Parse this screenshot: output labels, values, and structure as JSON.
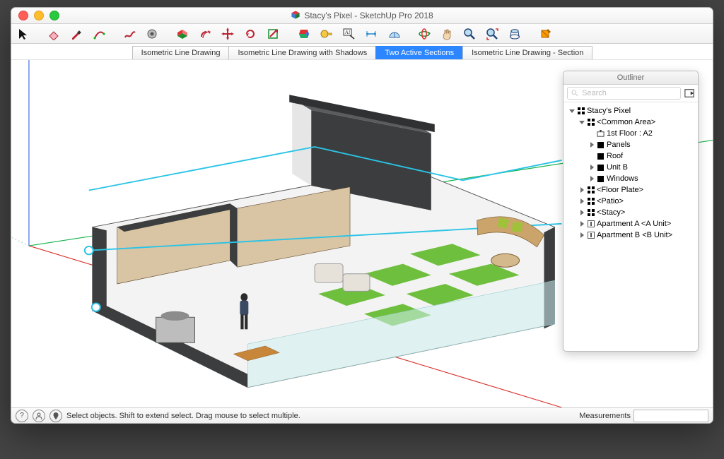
{
  "window": {
    "title": "Stacy's Pixel - SketchUp Pro 2018"
  },
  "scene_tabs": [
    {
      "label": "Isometric Line Drawing",
      "active": false
    },
    {
      "label": "Isometric Line Drawing with Shadows",
      "active": false
    },
    {
      "label": "Two Active Sections",
      "active": true
    },
    {
      "label": "Isometric Line Drawing - Section",
      "active": false
    }
  ],
  "outliner": {
    "title": "Outliner",
    "search_placeholder": "Search",
    "tree": [
      {
        "depth": 0,
        "arrow": "down",
        "icon": "open4",
        "label": "Stacy's Pixel"
      },
      {
        "depth": 1,
        "arrow": "down",
        "icon": "open4",
        "label": "<Common Area>"
      },
      {
        "depth": 2,
        "arrow": "none",
        "icon": "section",
        "label": "1st Floor : A2"
      },
      {
        "depth": 2,
        "arrow": "right",
        "icon": "solid",
        "label": "Panels"
      },
      {
        "depth": 2,
        "arrow": "none",
        "icon": "solid",
        "label": "Roof"
      },
      {
        "depth": 2,
        "arrow": "right",
        "icon": "solid",
        "label": "Unit B"
      },
      {
        "depth": 2,
        "arrow": "right",
        "icon": "solid",
        "label": "Windows"
      },
      {
        "depth": 1,
        "arrow": "right",
        "icon": "open4",
        "label": "<Floor Plate>"
      },
      {
        "depth": 1,
        "arrow": "right",
        "icon": "open4",
        "label": "<Patio>"
      },
      {
        "depth": 1,
        "arrow": "right",
        "icon": "open4",
        "label": "<Stacy>"
      },
      {
        "depth": 1,
        "arrow": "right",
        "icon": "comp",
        "label": "Apartment A <A Unit>"
      },
      {
        "depth": 1,
        "arrow": "right",
        "icon": "comp",
        "label": "Apartment B <B Unit>"
      }
    ]
  },
  "status": {
    "hint": "Select objects. Shift to extend select. Drag mouse to select multiple.",
    "measurements_label": "Measurements"
  },
  "toolbar_icons": [
    "select",
    "eraser",
    "pencil",
    "arc",
    "freehand",
    "shapes",
    "pushpull",
    "offset",
    "move",
    "rotate",
    "scale",
    "material",
    "tape",
    "text",
    "dim",
    "protractor",
    "orbit",
    "pan",
    "zoom",
    "zoom-extents",
    "walk",
    "section"
  ]
}
